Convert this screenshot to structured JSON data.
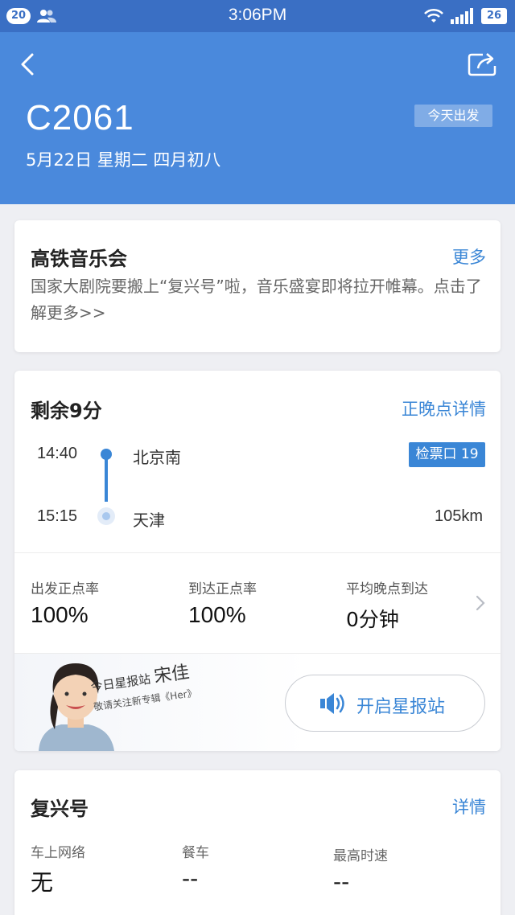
{
  "status_bar": {
    "notification_count": "20",
    "time": "3:06PM",
    "battery": "26",
    "icons": [
      "contacts-icon",
      "wifi-icon",
      "signal-icon",
      "battery-icon"
    ]
  },
  "header": {
    "back_icon": "back-arrow-icon",
    "share_icon": "share-icon",
    "train_number": "C2061",
    "depart_tag": "今天出发",
    "date": "5月22日 星期二 四月初八",
    "background_color": "#4a89dc"
  },
  "concert": {
    "title": "高铁音乐会",
    "more": "更多",
    "description": "国家大剧院要搬上“复兴号”啦，音乐盛宴即将拉开帷幕。点击了解更多>>"
  },
  "trip": {
    "remaining": "剩余9分",
    "details_link": "正晚点详情",
    "departure": {
      "time": "14:40",
      "station": "北京南",
      "gate": "检票口 19"
    },
    "arrival": {
      "time": "15:15",
      "station": "天津",
      "distance": "105km"
    },
    "stats": [
      {
        "label": "出发正点率",
        "value": "100%"
      },
      {
        "label": "到达正点率",
        "value": "100%"
      },
      {
        "label": "平均晚点到达",
        "value": "0分钟"
      }
    ],
    "accent_color": "#3a86d6"
  },
  "star_station": {
    "banner_line1_prefix": "今日星报站",
    "banner_name": "宋佳",
    "banner_line2": "敬请关注新专辑《Her》",
    "button_label": "开启星报站",
    "button_icon": "speaker-icon"
  },
  "train_info": {
    "title": "复兴号",
    "details_link": "详情",
    "items": [
      {
        "label": "车上网络",
        "value": "无"
      },
      {
        "label": "餐车",
        "value": "--"
      },
      {
        "label": "最高时速",
        "value": "--"
      }
    ]
  }
}
